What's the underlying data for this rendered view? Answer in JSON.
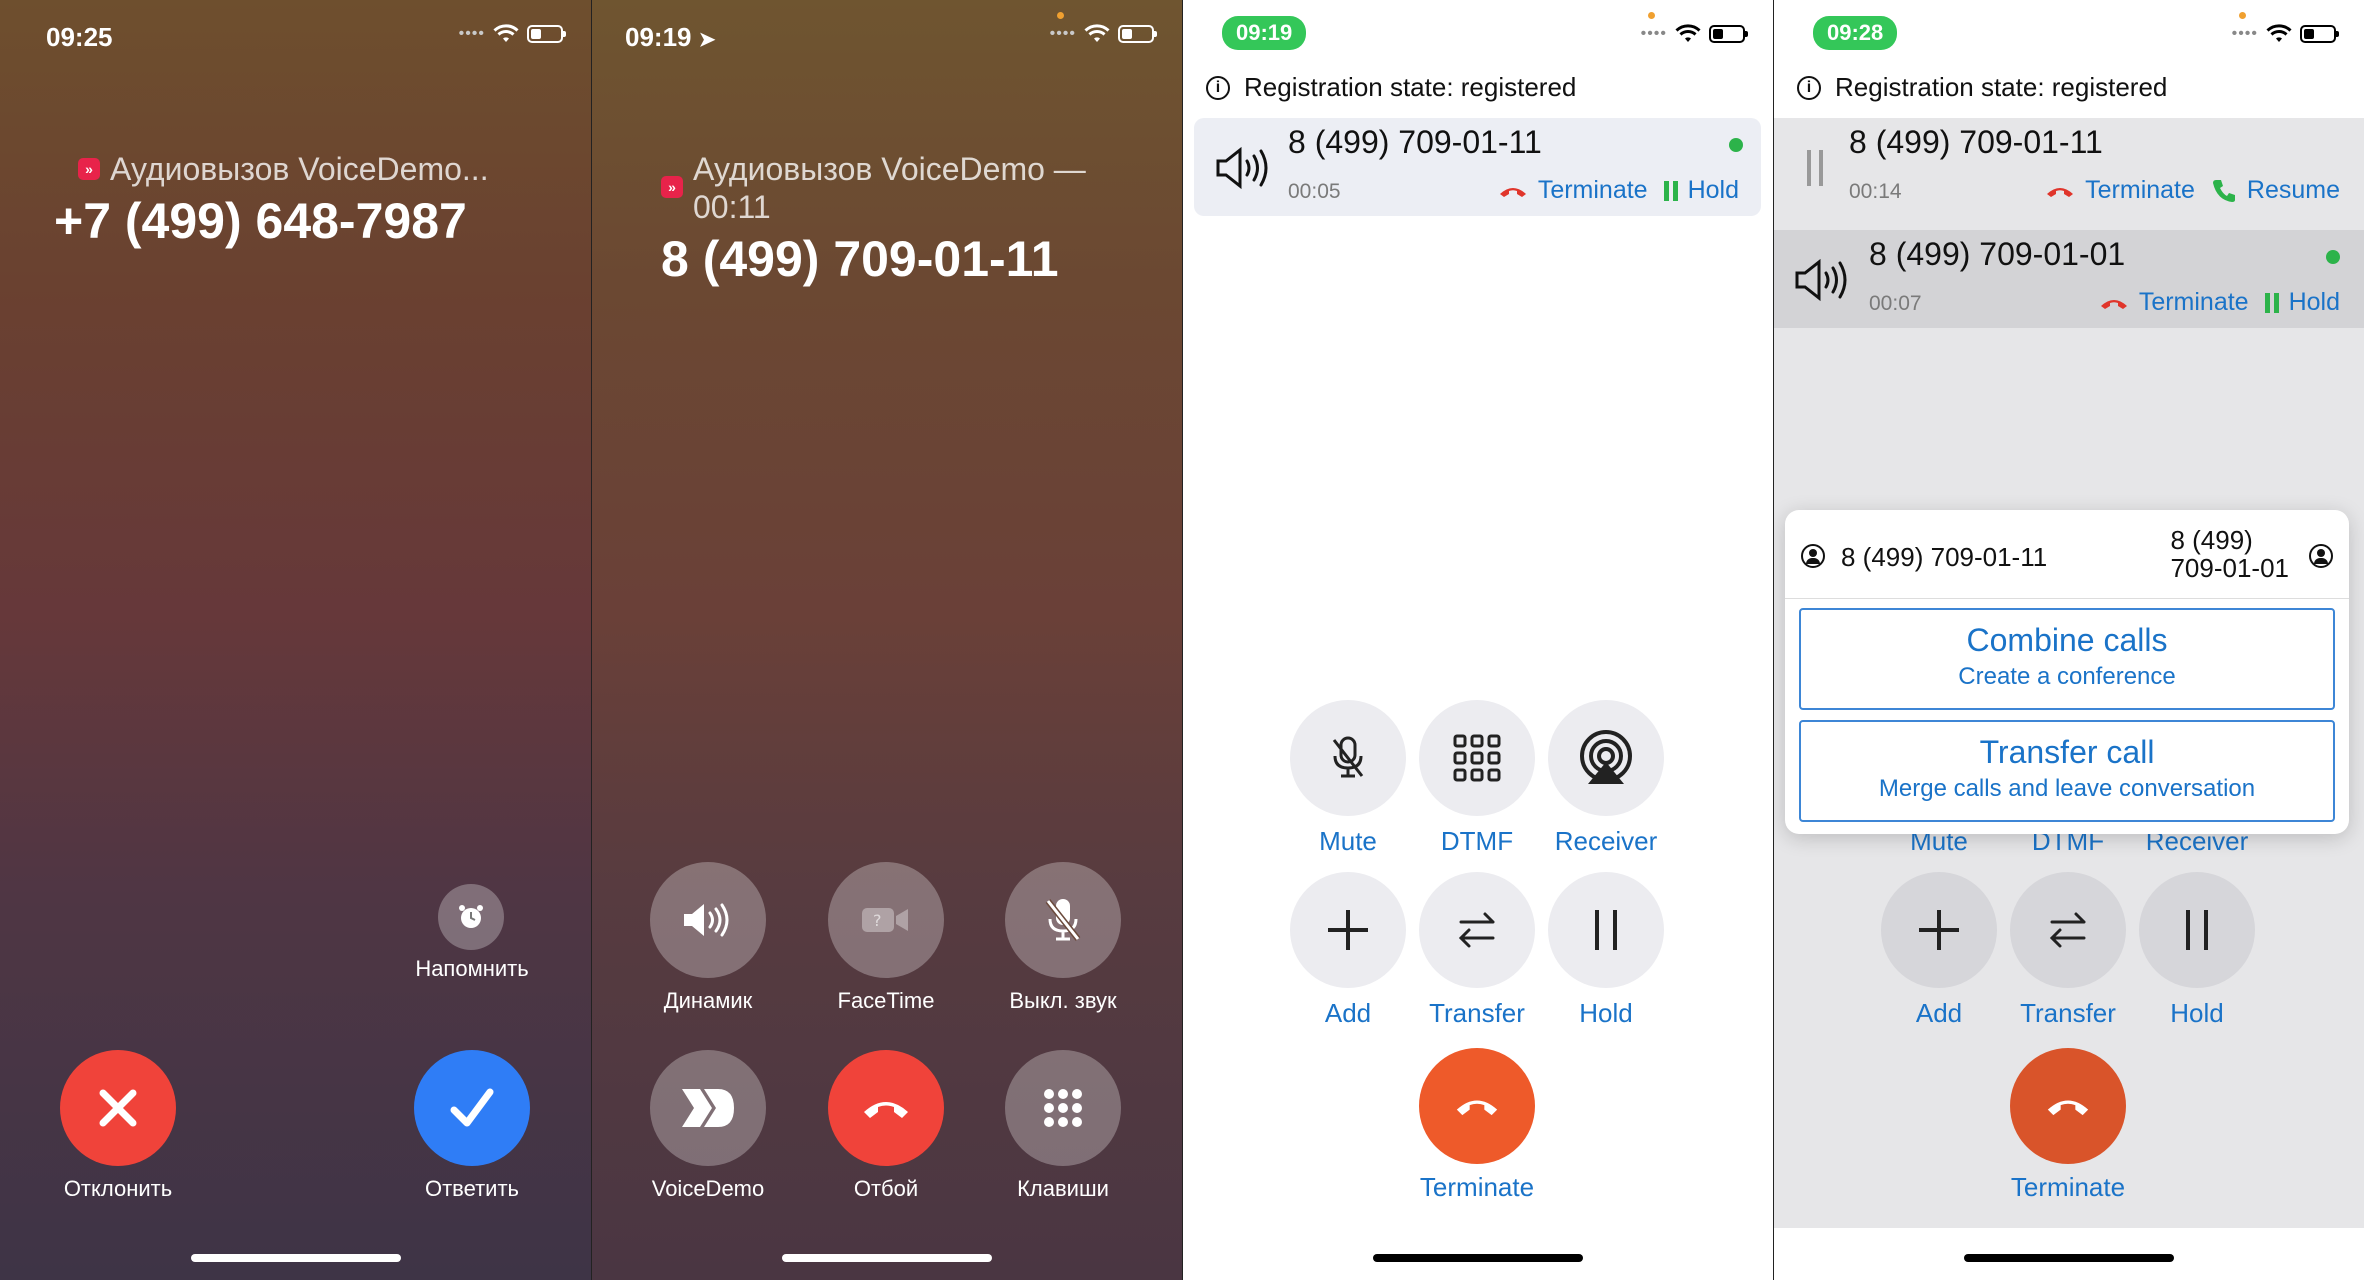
{
  "screen1": {
    "time": "09:25",
    "title": "Аудиовызов VoiceDemo...",
    "number": "+7 (499) 648-7987",
    "remind_label": "Напомнить",
    "decline_label": "Отклонить",
    "accept_label": "Ответить",
    "app_badge": "»",
    "icons": [
      "wifi-icon",
      "battery-icon",
      "alarm-icon",
      "close-icon",
      "checkmark-icon"
    ]
  },
  "screen2": {
    "time": "09:19",
    "title_line1": "Аудиовызов VoiceDemo —",
    "title_line2": "00:11",
    "number": "8 (499) 709-01-11",
    "buttons": [
      {
        "label": "Динамик",
        "icon": "speaker-icon"
      },
      {
        "label": "FaceTime",
        "icon": "facetime-icon"
      },
      {
        "label": "Выкл. звук",
        "icon": "mic-off-icon"
      },
      {
        "label": "VoiceDemo",
        "icon": "voicedemo-icon"
      },
      {
        "label": "Отбой",
        "icon": "end-call-icon"
      },
      {
        "label": "Клавиши",
        "icon": "keypad-icon"
      }
    ],
    "end_color": "#f0433a"
  },
  "screen3": {
    "time": "09:19",
    "registration": "Registration state: registered",
    "call": {
      "number": "8 (499) 709-01-11",
      "duration": "00:05",
      "terminate": "Terminate",
      "hold": "Hold"
    },
    "controls": [
      {
        "label": "Mute",
        "icon": "mic-off-icon"
      },
      {
        "label": "DTMF",
        "icon": "keypad-icon"
      },
      {
        "label": "Receiver",
        "icon": "airplay-icon"
      },
      {
        "label": "Add",
        "icon": "plus-icon"
      },
      {
        "label": "Transfer",
        "icon": "transfer-icon"
      },
      {
        "label": "Hold",
        "icon": "pause-icon"
      }
    ],
    "terminate_label": "Terminate",
    "accent": "#1a73c8",
    "terminate_color": "#ee5a2a"
  },
  "screen4": {
    "time": "09:28",
    "registration": "Registration state: registered",
    "call1": {
      "number": "8 (499) 709-01-11",
      "duration": "00:14",
      "terminate": "Terminate",
      "resume": "Resume"
    },
    "call2": {
      "number": "8 (499) 709-01-01",
      "duration": "00:07",
      "terminate": "Terminate",
      "hold": "Hold"
    },
    "popup": {
      "left_number": "8 (499) 709-01-11",
      "right_number_line1": "8 (499)",
      "right_number_line2": "709-01-01",
      "combine_title": "Combine calls",
      "combine_sub": "Create a conference",
      "transfer_title": "Transfer call",
      "transfer_sub": "Merge calls and leave conversation"
    },
    "hidden_labels": [
      "Mute",
      "DTMF",
      "Receiver"
    ],
    "controls": [
      {
        "label": "Add",
        "icon": "plus-icon"
      },
      {
        "label": "Transfer",
        "icon": "transfer-icon"
      },
      {
        "label": "Hold",
        "icon": "pause-icon"
      }
    ],
    "terminate_label": "Terminate"
  }
}
